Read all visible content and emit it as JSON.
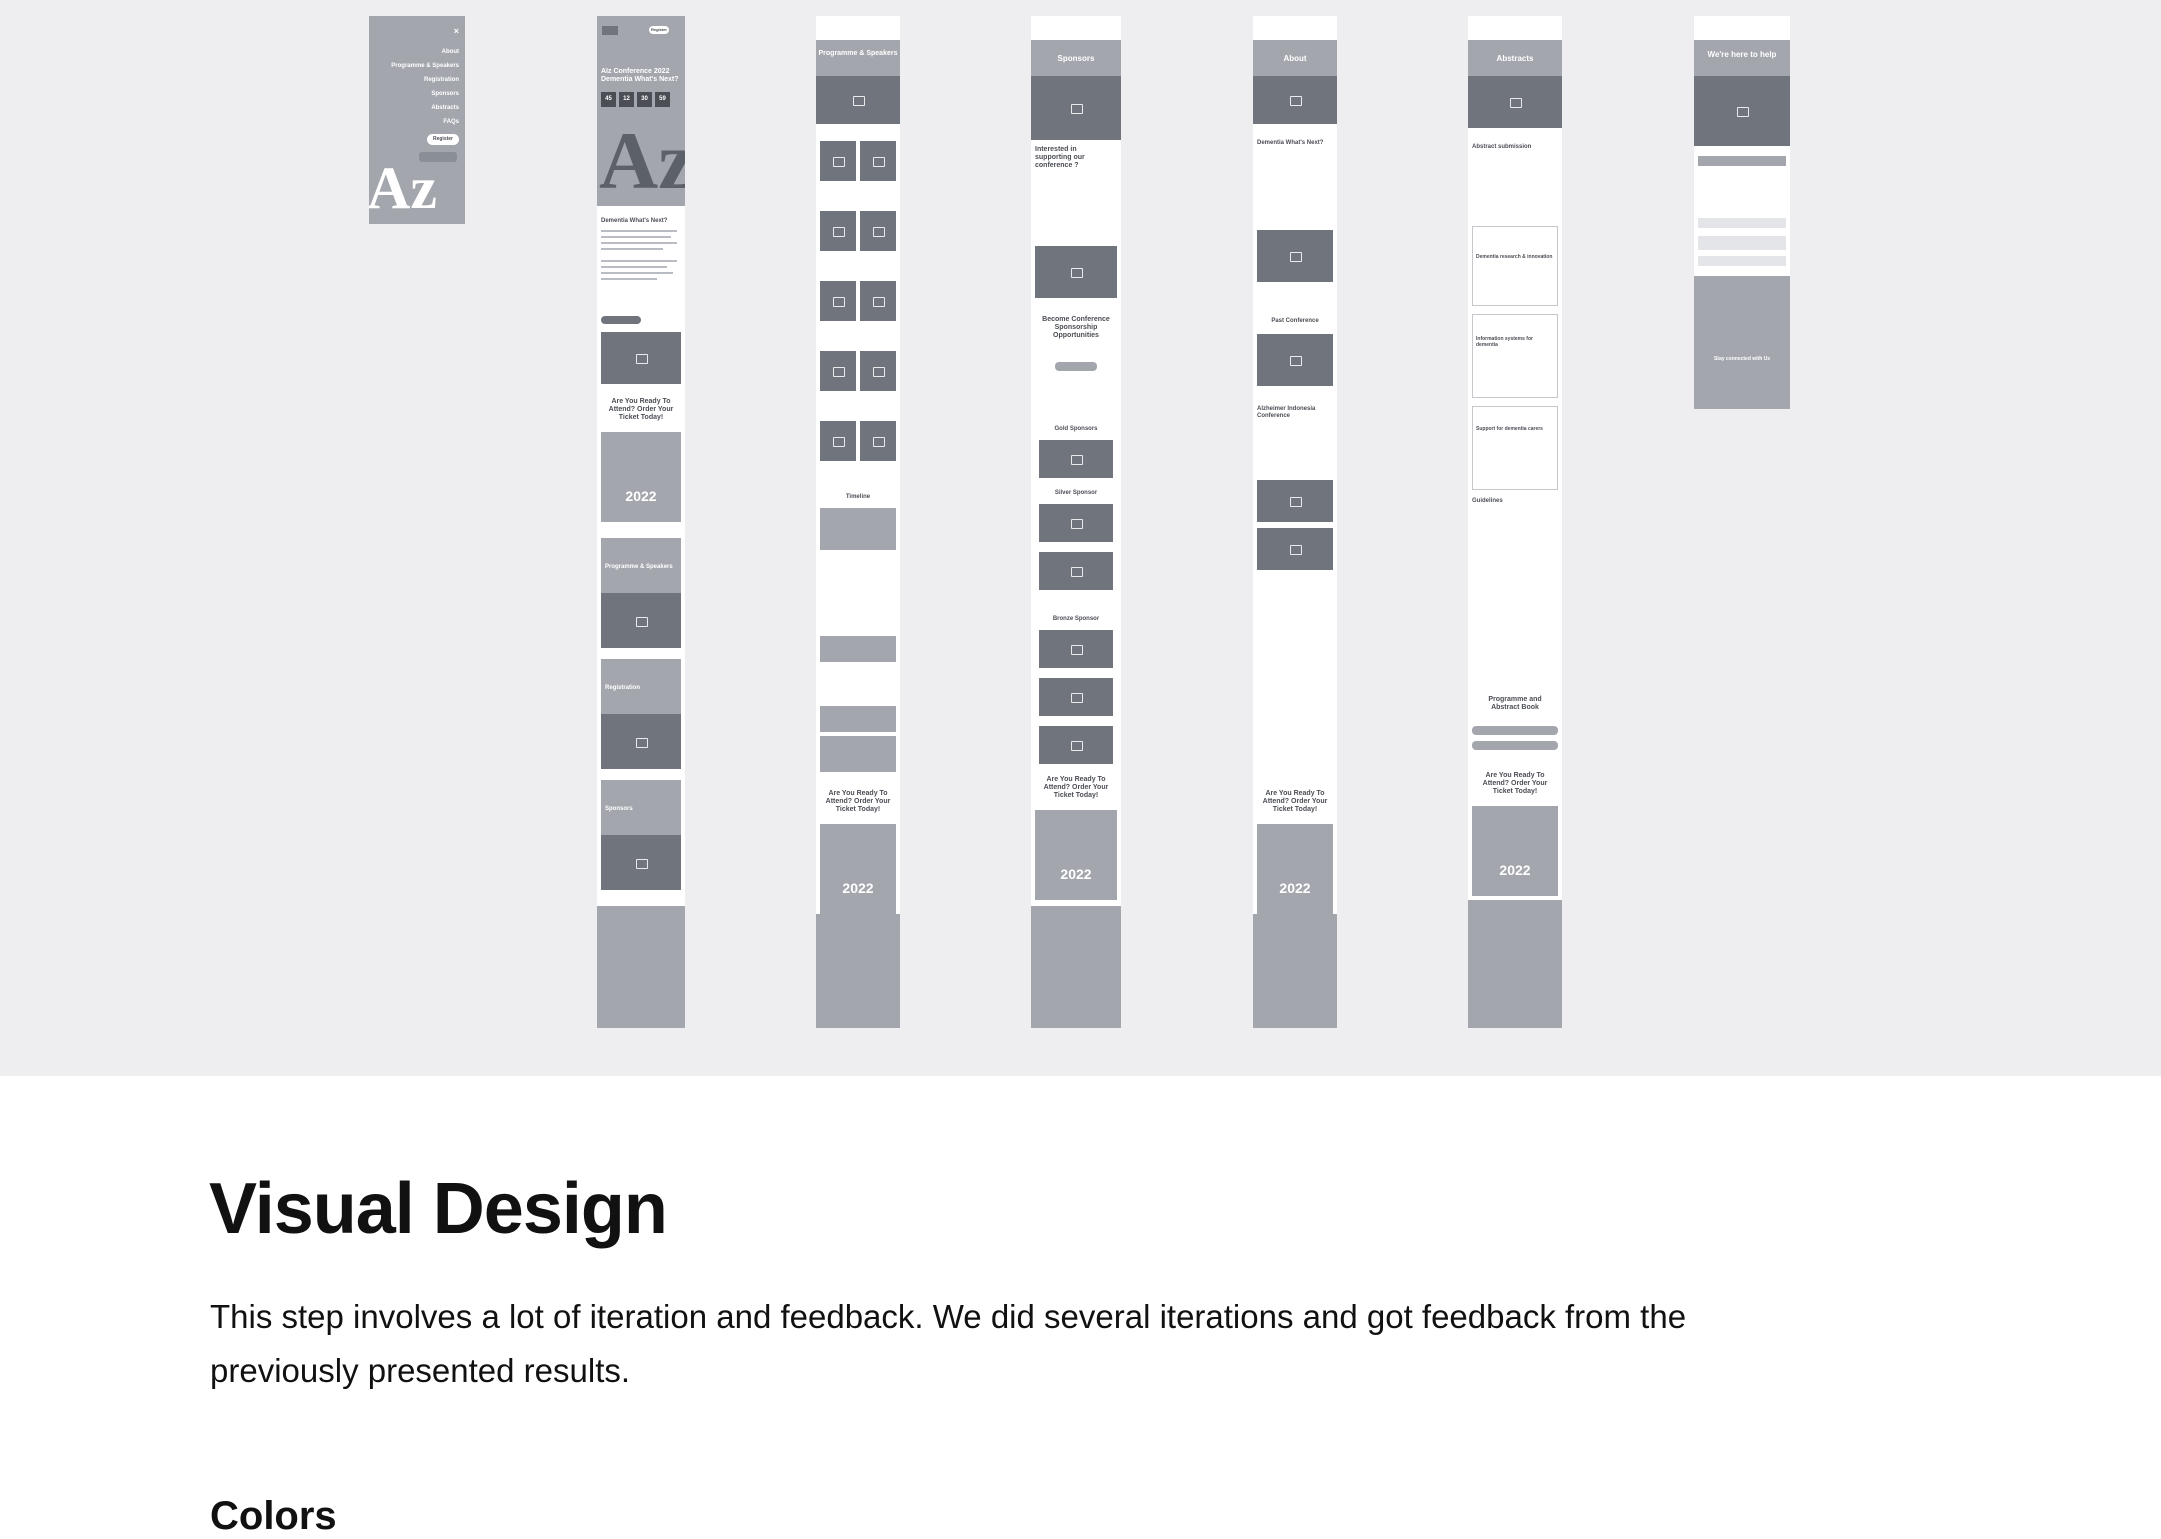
{
  "mockups": {
    "menu": {
      "items": [
        "About",
        "Programme & Speakers",
        "Registration",
        "Sponsors",
        "Abstracts",
        "FAQs"
      ],
      "register_label": "Register",
      "close_glyph": "×",
      "logo_text": "Az"
    },
    "home": {
      "register_label": "Register",
      "headline": "AIz Conference 2022 Dementia What's Next?",
      "countdown": [
        "45",
        "12",
        "30",
        "59"
      ],
      "logo_text": "Az",
      "section_title": "Dementia What's Next?",
      "cta_title": "Are You Ready To Attend? Order Your Ticket Today!",
      "year": "2022",
      "cards": [
        "Programme & Speakers",
        "Registration",
        "Sponsors"
      ]
    },
    "programme": {
      "title": "Programme & Speakers",
      "timeline_label": "Timeline",
      "cta_title": "Are You Ready To Attend? Order Your Ticket Today!",
      "year": "2022"
    },
    "sponsors": {
      "title": "Sponsors",
      "intro": "Interested in supporting our conference ?",
      "become": "Become Conference Sponsorship Opportunities",
      "tiers": [
        "Gold Sponsors",
        "Silver Sponsor",
        "Bronze Sponsor"
      ],
      "cta_title": "Are You Ready To Attend? Order Your Ticket Today!",
      "year": "2022"
    },
    "about": {
      "title": "About",
      "section_title": "Dementia What's Next?",
      "past": "Past Conference",
      "past_title": "Alzheimer Indonesia Conference",
      "cta_title": "Are You Ready To Attend? Order Your Ticket Today!",
      "year": "2022"
    },
    "abstracts": {
      "title": "Abstracts",
      "submission": "Abstract submission",
      "topics": [
        "Dementia research & innovation",
        "Information systems for dementia",
        "Support for dementia carers"
      ],
      "guidelines": "Guidelines",
      "book": "Programme and Abstract Book",
      "cta_title": "Are You Ready To Attend? Order Your Ticket Today!",
      "year": "2022"
    },
    "faq": {
      "title": "We're here to help",
      "connect": "Stay connected with Us"
    }
  },
  "content": {
    "heading": "Visual Design",
    "description": "This step involves a lot of iteration and feedback. We did several iterations and got feedback from the previously presented results.",
    "subheading": "Colors"
  },
  "colors": {
    "canvas": "#eeeef1",
    "wire_light": "#a3a6ad",
    "wire_dark": "#6f747d"
  }
}
